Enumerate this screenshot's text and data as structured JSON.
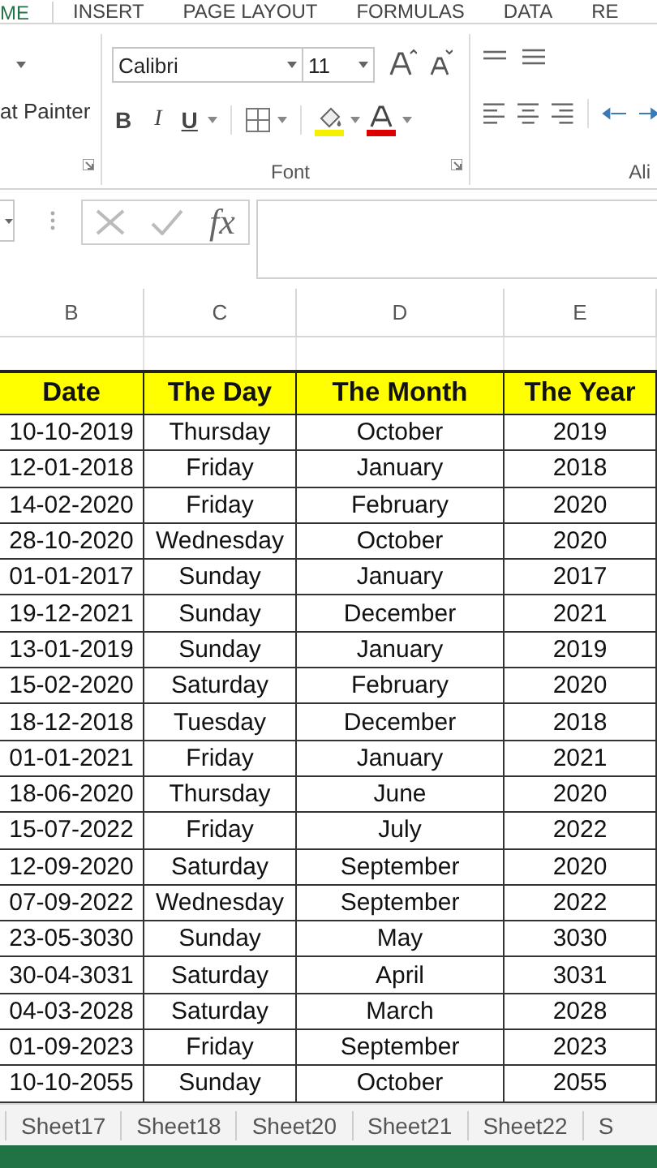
{
  "ribbon_tabs": [
    {
      "label": "ME",
      "selected": true
    },
    {
      "label": "INSERT",
      "selected": false
    },
    {
      "label": "PAGE LAYOUT",
      "selected": false
    },
    {
      "label": "FORMULAS",
      "selected": false
    },
    {
      "label": "DATA",
      "selected": false
    },
    {
      "label": "RE",
      "selected": false
    }
  ],
  "clipboard_group": {
    "format_painter": "at Painter"
  },
  "font_group": {
    "label": "Font",
    "font_name": "Calibri",
    "font_size": "11",
    "bold": "B",
    "italic": "I",
    "underline": "U"
  },
  "alignment_group": {
    "label": "Ali"
  },
  "formula_bar": {
    "function_label": "fx"
  },
  "sheet": {
    "columns": [
      "B",
      "C",
      "D",
      "E"
    ],
    "header": [
      "Date",
      "The Day",
      "The Month",
      "The Year"
    ],
    "rows": [
      [
        "10-10-2019",
        "Thursday",
        "October",
        "2019"
      ],
      [
        "12-01-2018",
        "Friday",
        "January",
        "2018"
      ],
      [
        "14-02-2020",
        "Friday",
        "February",
        "2020"
      ],
      [
        "28-10-2020",
        "Wednesday",
        "October",
        "2020"
      ],
      [
        "01-01-2017",
        "Sunday",
        "January",
        "2017"
      ],
      [
        "19-12-2021",
        "Sunday",
        "December",
        "2021"
      ],
      [
        "13-01-2019",
        "Sunday",
        "January",
        "2019"
      ],
      [
        "15-02-2020",
        "Saturday",
        "February",
        "2020"
      ],
      [
        "18-12-2018",
        "Tuesday",
        "December",
        "2018"
      ],
      [
        "01-01-2021",
        "Friday",
        "January",
        "2021"
      ],
      [
        "18-06-2020",
        "Thursday",
        "June",
        "2020"
      ],
      [
        "15-07-2022",
        "Friday",
        "July",
        "2022"
      ],
      [
        "12-09-2020",
        "Saturday",
        "September",
        "2020"
      ],
      [
        "07-09-2022",
        "Wednesday",
        "September",
        "2022"
      ],
      [
        "23-05-3030",
        "Sunday",
        "May",
        "3030"
      ],
      [
        "30-04-3031",
        "Saturday",
        "April",
        "3031"
      ],
      [
        "04-03-2028",
        "Saturday",
        "March",
        "2028"
      ],
      [
        "01-09-2023",
        "Friday",
        "September",
        "2023"
      ],
      [
        "10-10-2055",
        "Sunday",
        "October",
        "2055"
      ]
    ]
  },
  "sheet_tabs": [
    {
      "label": "Sheet17",
      "selected": false
    },
    {
      "label": "Sheet18",
      "selected": false
    },
    {
      "label": "Sheet20",
      "selected": false
    },
    {
      "label": "Sheet21",
      "selected": false
    },
    {
      "label": "Sheet22",
      "selected": false
    },
    {
      "label": "S",
      "selected": false
    }
  ]
}
